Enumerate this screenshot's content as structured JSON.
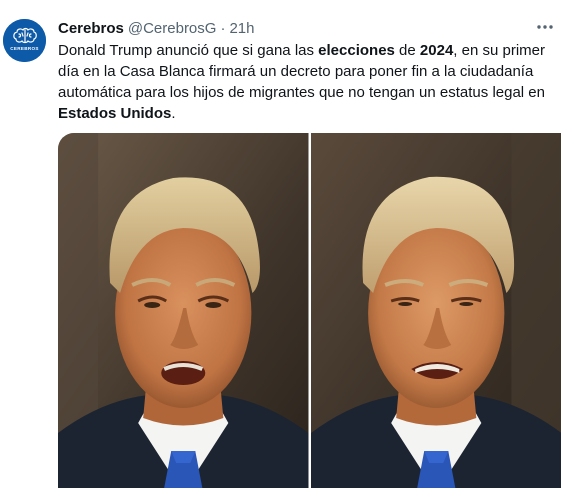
{
  "tweet": {
    "author_name": "Cerebros",
    "author_handle": "@CerebrosG",
    "separator": "·",
    "time": "21h",
    "text_parts": [
      {
        "t": "Donald Trump anunció que si gana las ",
        "b": false
      },
      {
        "t": "elecciones",
        "b": true
      },
      {
        "t": " de ",
        "b": false
      },
      {
        "t": "2024",
        "b": true
      },
      {
        "t": ", en su primer día en la Casa Blanca firmará un decreto para poner fin a la ciudadanía automática para los hijos de migrantes que no tengan un estatus legal en ",
        "b": false
      },
      {
        "t": "Estados Unidos",
        "b": true
      },
      {
        "t": ".",
        "b": false
      }
    ],
    "avatar_text": "CEREBROS",
    "icons": {
      "more": "more-options-icon",
      "avatar": "brain-logo-icon"
    },
    "colors": {
      "avatar_bg": "#0d5aa8",
      "secondary_text": "#536471"
    }
  }
}
